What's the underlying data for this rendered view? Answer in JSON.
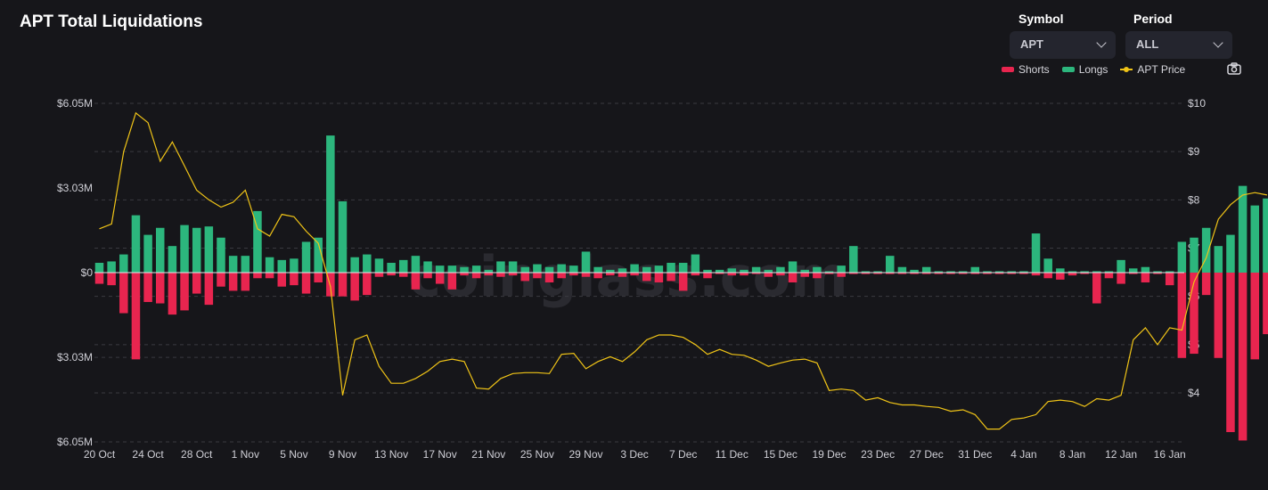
{
  "title": "APT Total Liquidations",
  "controls": {
    "symbol_label": "Symbol",
    "symbol_value": "APT",
    "period_label": "Period",
    "period_value": "ALL"
  },
  "legend": {
    "shorts": "Shorts",
    "longs": "Longs",
    "price": "APT Price"
  },
  "watermark": "coinglass.com",
  "colors": {
    "shorts": "#e8254f",
    "longs": "#2cb67d",
    "price": "#f0c417",
    "grid": "#3a3a40",
    "background": "#16161a"
  },
  "chart_data": {
    "type": "bar",
    "title": "APT Total Liquidations",
    "left_axis": {
      "ticks": [
        "$6.05M",
        "$3.03M",
        "$0",
        "$3.03M",
        "$6.05M"
      ],
      "tick_values": [
        6.05,
        3.03,
        0,
        -3.03,
        -6.05
      ],
      "range": [
        -6.05,
        6.05
      ],
      "unit": "USD millions"
    },
    "right_axis": {
      "ticks": [
        "$10",
        "$9",
        "$8",
        "$7",
        "$6",
        "$5",
        "$4"
      ],
      "tick_values": [
        10,
        9,
        8,
        7,
        6,
        5,
        4
      ],
      "range": [
        3,
        10
      ],
      "unit": "USD"
    },
    "x_ticks": [
      "20 Oct",
      "24 Oct",
      "28 Oct",
      "1 Nov",
      "5 Nov",
      "9 Nov",
      "13 Nov",
      "17 Nov",
      "21 Nov",
      "25 Nov",
      "29 Nov",
      "3 Dec",
      "7 Dec",
      "11 Dec",
      "15 Dec",
      "19 Dec",
      "23 Dec",
      "27 Dec",
      "31 Dec",
      "4 Jan",
      "8 Jan",
      "12 Jan",
      "16 Jan"
    ],
    "x_start": "2022-10-20",
    "grid": true,
    "legend_position": "top-right",
    "series": [
      {
        "name": "Longs",
        "values": [
          0.35,
          0.4,
          0.65,
          2.05,
          1.35,
          1.6,
          0.95,
          1.7,
          1.6,
          1.65,
          1.25,
          0.6,
          0.6,
          2.2,
          0.55,
          0.45,
          0.5,
          1.1,
          1.25,
          4.9,
          2.55,
          0.55,
          0.65,
          0.5,
          0.35,
          0.45,
          0.6,
          0.4,
          0.25,
          0.25,
          0.2,
          0.25,
          0.1,
          0.4,
          0.4,
          0.2,
          0.3,
          0.2,
          0.3,
          0.25,
          0.75,
          0.2,
          0.1,
          0.15,
          0.3,
          0.2,
          0.25,
          0.35,
          0.35,
          0.65,
          0.1,
          0.1,
          0.15,
          0.1,
          0.2,
          0.1,
          0.2,
          0.4,
          0.1,
          0.2,
          0.05,
          0.25,
          0.95,
          0.05,
          0.05,
          0.6,
          0.2,
          0.1,
          0.2,
          0.05,
          0.05,
          0.05,
          0.2,
          0.05,
          0.05,
          0.05,
          0.05,
          1.4,
          0.5,
          0.15,
          0.05,
          0.05,
          0.05,
          0.05,
          0.45,
          0.15,
          0.2,
          0.05,
          0.05,
          1.1,
          1.25,
          1.6,
          0.95,
          1.35,
          3.1,
          2.4,
          2.65,
          0.55
        ],
        "color": "#2cb67d"
      },
      {
        "name": "Shorts",
        "values": [
          -0.4,
          -0.45,
          -1.45,
          -3.1,
          -1.05,
          -1.1,
          -1.5,
          -1.35,
          -0.75,
          -1.15,
          -0.5,
          -0.65,
          -0.65,
          -0.2,
          -0.2,
          -0.5,
          -0.45,
          -0.75,
          -0.35,
          -0.85,
          -0.85,
          -1.0,
          -0.8,
          -0.15,
          -0.1,
          -0.15,
          -0.6,
          -0.2,
          -0.4,
          -0.6,
          -0.1,
          -0.2,
          -0.1,
          -0.15,
          -0.1,
          -0.3,
          -0.2,
          -0.35,
          -0.2,
          -0.1,
          -0.15,
          -0.2,
          -0.1,
          -0.15,
          -0.1,
          -0.3,
          -0.35,
          -0.3,
          -0.65,
          -0.1,
          -0.2,
          -0.05,
          -0.1,
          -0.1,
          -0.05,
          -0.15,
          -0.1,
          -0.35,
          -0.15,
          -0.2,
          -0.05,
          -0.15,
          -0.05,
          -0.05,
          -0.05,
          -0.05,
          -0.05,
          -0.05,
          -0.05,
          -0.05,
          -0.05,
          -0.05,
          -0.05,
          -0.05,
          -0.05,
          -0.05,
          -0.05,
          -0.1,
          -0.2,
          -0.25,
          -0.1,
          -0.05,
          -1.1,
          -0.2,
          -0.4,
          -0.05,
          -0.35,
          -0.05,
          -0.45,
          -3.05,
          -2.9,
          -0.8,
          -3.05,
          -5.7,
          -6.0,
          -3.1,
          -2.2,
          -0.1
        ],
        "color": "#e8254f"
      },
      {
        "name": "APT Price",
        "values": [
          7.4,
          7.5,
          9.0,
          9.8,
          9.6,
          8.8,
          9.2,
          8.7,
          8.2,
          8.0,
          7.85,
          7.95,
          8.2,
          7.4,
          7.25,
          7.7,
          7.65,
          7.35,
          7.1,
          6.2,
          3.95,
          5.1,
          5.2,
          4.55,
          4.2,
          4.2,
          4.3,
          4.45,
          4.65,
          4.7,
          4.65,
          4.1,
          4.08,
          4.3,
          4.4,
          4.42,
          4.42,
          4.4,
          4.8,
          4.82,
          4.5,
          4.65,
          4.75,
          4.65,
          4.85,
          5.1,
          5.2,
          5.2,
          5.15,
          5.0,
          4.8,
          4.9,
          4.8,
          4.78,
          4.68,
          4.55,
          4.62,
          4.68,
          4.7,
          4.62,
          4.05,
          4.08,
          4.05,
          3.85,
          3.9,
          3.8,
          3.75,
          3.75,
          3.72,
          3.7,
          3.62,
          3.65,
          3.55,
          3.25,
          3.25,
          3.45,
          3.48,
          3.55,
          3.82,
          3.85,
          3.82,
          3.72,
          3.88,
          3.85,
          3.95,
          5.1,
          5.35,
          5.0,
          5.35,
          5.3,
          6.3,
          6.8,
          7.6,
          7.9,
          8.1,
          8.15,
          8.1
        ],
        "color": "#f0c417"
      }
    ]
  }
}
